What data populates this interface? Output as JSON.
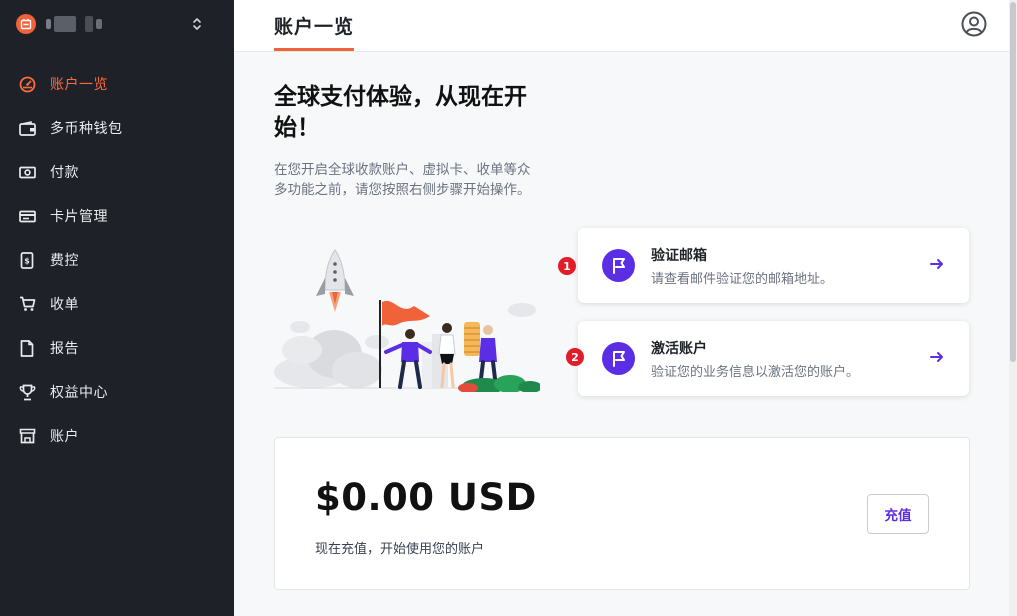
{
  "sidebar": {
    "account_switch_icon": "chevron-up-down-icon",
    "items": [
      {
        "label": "账户一览",
        "icon": "dashboard-gauge-icon",
        "active": true
      },
      {
        "label": "多币种钱包",
        "icon": "wallet-icon"
      },
      {
        "label": "付款",
        "icon": "cash-icon"
      },
      {
        "label": "卡片管理",
        "icon": "card-icon"
      },
      {
        "label": "费控",
        "icon": "receipt-icon"
      },
      {
        "label": "收单",
        "icon": "cart-icon"
      },
      {
        "label": "报告",
        "icon": "document-icon"
      },
      {
        "label": "权益中心",
        "icon": "trophy-icon"
      },
      {
        "label": "账户",
        "icon": "store-icon"
      }
    ]
  },
  "header": {
    "title": "账户一览",
    "user_icon": "user-circle-icon"
  },
  "hero": {
    "title": "全球支付体验，从现在开始！",
    "description": "在您开启全球收款账户、虚拟卡、收单等众多功能之前，请您按照右侧步骤开始操作。"
  },
  "steps": [
    {
      "number": "1",
      "title": "验证邮箱",
      "description": "请查看邮件验证您的邮箱地址。",
      "icon": "flag-icon"
    },
    {
      "number": "2",
      "title": "激活账户",
      "description": "验证您的业务信息以激活您的账户。",
      "icon": "flag-icon"
    }
  ],
  "balance": {
    "amount": "$0.00 USD",
    "description": "现在充值，开始使用您的账户",
    "topup_label": "充值"
  },
  "colors": {
    "sidebar_bg": "#1e2228",
    "accent_orange": "#f0623a",
    "accent_purple": "#5b2ee6",
    "step_badge_red": "#e11d2a"
  }
}
